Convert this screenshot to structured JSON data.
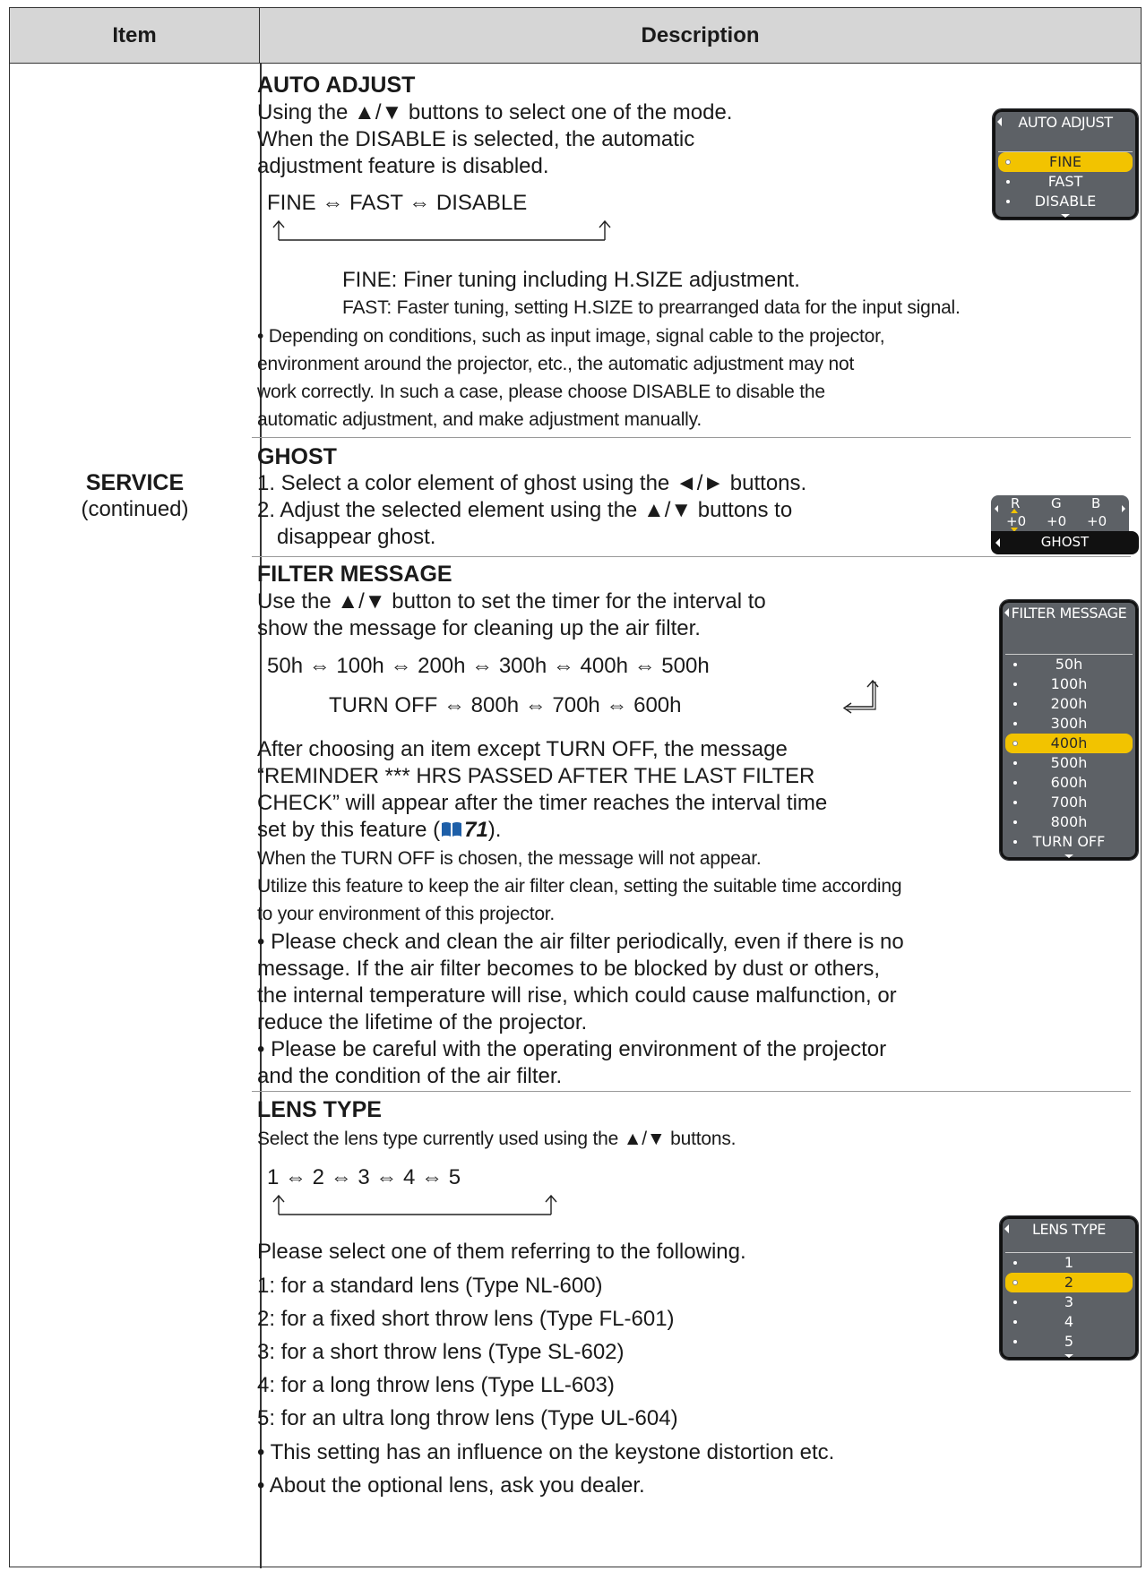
{
  "header": {
    "item": "Item",
    "description": "Description"
  },
  "item": {
    "name": "SERVICE",
    "sub": "(continued)"
  },
  "auto_adjust": {
    "title": "AUTO ADJUST",
    "l1": "Using the ▲/▼ buttons to select one of the mode.",
    "l2": "When the DISABLE is selected, the automatic",
    "l3": "adjustment feature is disabled.",
    "cycle": "FINE ⇔ FAST ⇔ DISABLE",
    "fine": "FINE: Finer tuning including H.SIZE adjustment.",
    "fast": "FAST: Faster tuning, setting H.SIZE to prearranged data for the input signal.",
    "n1": "• Depending on conditions, such as input image, signal cable to the projector,",
    "n2": "environment around the projector, etc., the automatic adjustment may not",
    "n3": "work correctly.  In such a case, please choose DISABLE to disable the",
    "n4": "automatic adjustment, and make adjustment manually.",
    "menu": {
      "title": "AUTO ADJUST",
      "options": [
        "FINE",
        "FAST",
        "DISABLE"
      ],
      "selected": "FINE"
    }
  },
  "ghost": {
    "title": "GHOST",
    "l1": "1. Select a color element of ghost using the ◄/► buttons.",
    "l2": "2. Adjust the selected element using the ▲/▼ buttons to",
    "l3": "disappear ghost.",
    "menu": {
      "labels": [
        "R",
        "G",
        "B"
      ],
      "values": [
        "+0",
        "+0",
        "+0"
      ],
      "title": "GHOST"
    }
  },
  "filter": {
    "title": "FILTER MESSAGE",
    "l1": "Use the ▲/▼ button to set the timer for the interval to",
    "l2": "show the message for cleaning up the air filter.",
    "cycle1": "50h ⇔ 100h ⇔ 200h ⇔ 300h ⇔ 400h ⇔ 500h",
    "cycle2": "TURN OFF ⇔ 800h ⇔ 700h ⇔ 600h",
    "p1": "After choosing an item except TURN OFF, the message",
    "p2": "“REMINDER *** HRS PASSED AFTER THE LAST FILTER",
    "p3": "CHECK” will appear after the timer reaches the interval time",
    "p4a": "set by this feature (",
    "p4ref": "71",
    "p4b": ").",
    "p5": "When the TURN OFF is chosen, the message will not appear.",
    "p6": "Utilize this feature to keep the air filter clean, setting the suitable time according",
    "p7": "to your environment of this projector.",
    "b1": "• Please check and clean the air filter periodically, even if there is no",
    "b2": "message. If the air filter becomes to be blocked by dust or others,",
    "b3": "the internal temperature will rise, which could cause malfunction, or",
    "b4": "reduce the lifetime of the projector.",
    "b5": "• Please be careful with the operating environment of the projector",
    "b6": "and the condition of the air filter.",
    "menu": {
      "title": "FILTER MESSAGE",
      "options": [
        "50h",
        "100h",
        "200h",
        "300h",
        "400h",
        "500h",
        "600h",
        "700h",
        "800h",
        "TURN OFF"
      ],
      "selected": "400h"
    }
  },
  "lens": {
    "title": "LENS TYPE",
    "l1": "Select the lens type currently used using the ▲/▼ buttons.",
    "cycle": "1 ⇔ 2 ⇔ 3 ⇔ 4 ⇔ 5",
    "p1": "Please select one of them referring to the following.",
    "o1": "1: for a standard lens (Type NL-600)",
    "o2": "2: for a fixed short throw lens (Type FL-601)",
    "o3": "3: for a short throw lens (Type SL-602)",
    "o4": "4: for a long throw lens (Type LL-603)",
    "o5": "5: for an ultra long throw lens (Type UL-604)",
    "b1": "• This setting has an influence on the keystone distortion etc.",
    "b2": "• About the optional lens, ask you dealer.",
    "menu": {
      "title": "LENS TYPE",
      "options": [
        "1",
        "2",
        "3",
        "4",
        "5"
      ],
      "selected": "2"
    }
  }
}
